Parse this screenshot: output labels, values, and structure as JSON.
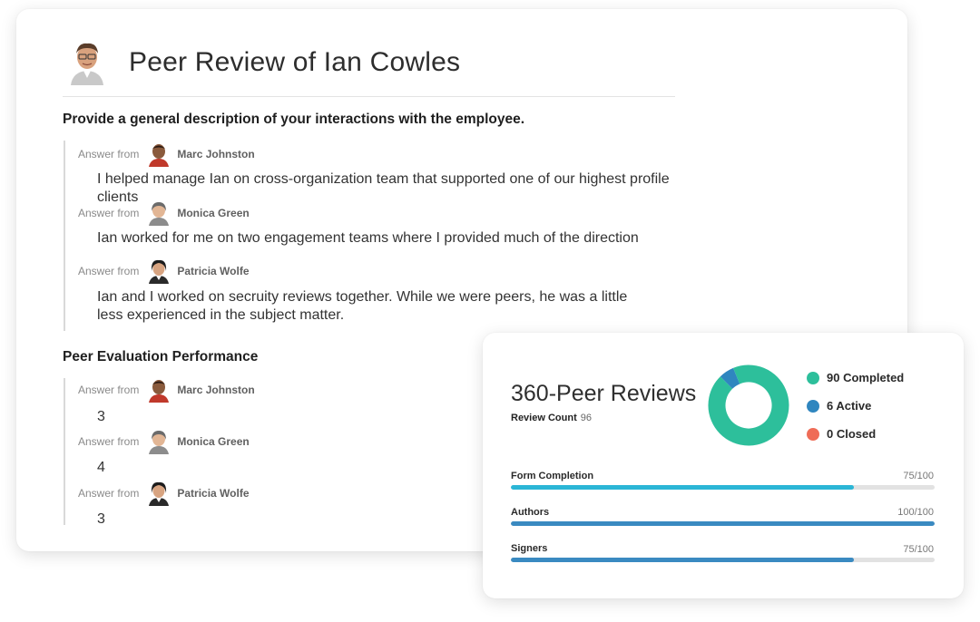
{
  "page_title": "Peer Review of Ian Cowles",
  "sections": [
    {
      "question": "Provide a general description of your interactions with the employee.",
      "answers": [
        {
          "label": "Answer from",
          "author": "Marc Johnston",
          "text": "I helped manage Ian on cross-organization team that supported one of our highest profile clients"
        },
        {
          "label": "Answer from",
          "author": "Monica Green",
          "text": "Ian worked for me on two engagement teams where I provided much of the direction"
        },
        {
          "label": "Answer from",
          "author": "Patricia Wolfe",
          "text": "Ian and I worked on secruity reviews together. While we were peers, he was a little less experienced in the subject matter."
        }
      ]
    },
    {
      "question": "Peer Evaluation Performance",
      "answers": [
        {
          "label": "Answer from",
          "author": "Marc Johnston",
          "text": "3"
        },
        {
          "label": "Answer from",
          "author": "Monica Green",
          "text": "4"
        },
        {
          "label": "Answer from",
          "author": "Patricia Wolfe",
          "text": "3"
        }
      ]
    }
  ],
  "stats": {
    "title": "360-Peer Reviews",
    "review_count_label": "Review Count",
    "review_count": "96",
    "legend": [
      {
        "label": "90 Completed",
        "value": 90,
        "color": "#2dbf9b"
      },
      {
        "label": "6 Active",
        "value": 6,
        "color": "#2f86bf"
      },
      {
        "label": "0 Closed",
        "value": 0,
        "color": "#ef6c57"
      }
    ],
    "progress": [
      {
        "label": "Form Completion",
        "value_text": "75/100",
        "fraction": 0.81,
        "color": "#2bb6d6"
      },
      {
        "label": "Authors",
        "value_text": "100/100",
        "fraction": 1.0,
        "color": "#3a8ac1"
      },
      {
        "label": "Signers",
        "value_text": "75/100",
        "fraction": 0.81,
        "color": "#3a8ac1"
      }
    ]
  }
}
